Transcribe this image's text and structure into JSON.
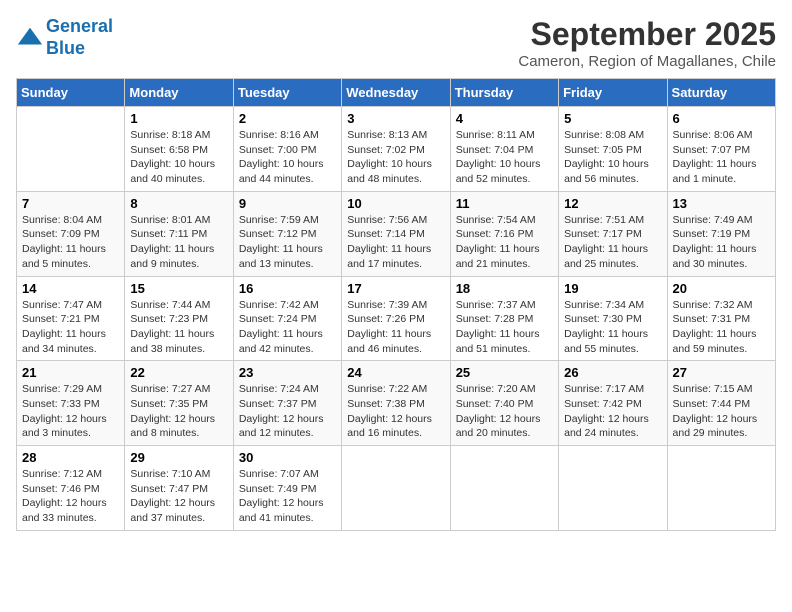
{
  "header": {
    "logo_line1": "General",
    "logo_line2": "Blue",
    "month_title": "September 2025",
    "subtitle": "Cameron, Region of Magallanes, Chile"
  },
  "calendar": {
    "days_of_week": [
      "Sunday",
      "Monday",
      "Tuesday",
      "Wednesday",
      "Thursday",
      "Friday",
      "Saturday"
    ],
    "weeks": [
      [
        {
          "day": "",
          "info": ""
        },
        {
          "day": "1",
          "info": "Sunrise: 8:18 AM\nSunset: 6:58 PM\nDaylight: 10 hours\nand 40 minutes."
        },
        {
          "day": "2",
          "info": "Sunrise: 8:16 AM\nSunset: 7:00 PM\nDaylight: 10 hours\nand 44 minutes."
        },
        {
          "day": "3",
          "info": "Sunrise: 8:13 AM\nSunset: 7:02 PM\nDaylight: 10 hours\nand 48 minutes."
        },
        {
          "day": "4",
          "info": "Sunrise: 8:11 AM\nSunset: 7:04 PM\nDaylight: 10 hours\nand 52 minutes."
        },
        {
          "day": "5",
          "info": "Sunrise: 8:08 AM\nSunset: 7:05 PM\nDaylight: 10 hours\nand 56 minutes."
        },
        {
          "day": "6",
          "info": "Sunrise: 8:06 AM\nSunset: 7:07 PM\nDaylight: 11 hours\nand 1 minute."
        }
      ],
      [
        {
          "day": "7",
          "info": "Sunrise: 8:04 AM\nSunset: 7:09 PM\nDaylight: 11 hours\nand 5 minutes."
        },
        {
          "day": "8",
          "info": "Sunrise: 8:01 AM\nSunset: 7:11 PM\nDaylight: 11 hours\nand 9 minutes."
        },
        {
          "day": "9",
          "info": "Sunrise: 7:59 AM\nSunset: 7:12 PM\nDaylight: 11 hours\nand 13 minutes."
        },
        {
          "day": "10",
          "info": "Sunrise: 7:56 AM\nSunset: 7:14 PM\nDaylight: 11 hours\nand 17 minutes."
        },
        {
          "day": "11",
          "info": "Sunrise: 7:54 AM\nSunset: 7:16 PM\nDaylight: 11 hours\nand 21 minutes."
        },
        {
          "day": "12",
          "info": "Sunrise: 7:51 AM\nSunset: 7:17 PM\nDaylight: 11 hours\nand 25 minutes."
        },
        {
          "day": "13",
          "info": "Sunrise: 7:49 AM\nSunset: 7:19 PM\nDaylight: 11 hours\nand 30 minutes."
        }
      ],
      [
        {
          "day": "14",
          "info": "Sunrise: 7:47 AM\nSunset: 7:21 PM\nDaylight: 11 hours\nand 34 minutes."
        },
        {
          "day": "15",
          "info": "Sunrise: 7:44 AM\nSunset: 7:23 PM\nDaylight: 11 hours\nand 38 minutes."
        },
        {
          "day": "16",
          "info": "Sunrise: 7:42 AM\nSunset: 7:24 PM\nDaylight: 11 hours\nand 42 minutes."
        },
        {
          "day": "17",
          "info": "Sunrise: 7:39 AM\nSunset: 7:26 PM\nDaylight: 11 hours\nand 46 minutes."
        },
        {
          "day": "18",
          "info": "Sunrise: 7:37 AM\nSunset: 7:28 PM\nDaylight: 11 hours\nand 51 minutes."
        },
        {
          "day": "19",
          "info": "Sunrise: 7:34 AM\nSunset: 7:30 PM\nDaylight: 11 hours\nand 55 minutes."
        },
        {
          "day": "20",
          "info": "Sunrise: 7:32 AM\nSunset: 7:31 PM\nDaylight: 11 hours\nand 59 minutes."
        }
      ],
      [
        {
          "day": "21",
          "info": "Sunrise: 7:29 AM\nSunset: 7:33 PM\nDaylight: 12 hours\nand 3 minutes."
        },
        {
          "day": "22",
          "info": "Sunrise: 7:27 AM\nSunset: 7:35 PM\nDaylight: 12 hours\nand 8 minutes."
        },
        {
          "day": "23",
          "info": "Sunrise: 7:24 AM\nSunset: 7:37 PM\nDaylight: 12 hours\nand 12 minutes."
        },
        {
          "day": "24",
          "info": "Sunrise: 7:22 AM\nSunset: 7:38 PM\nDaylight: 12 hours\nand 16 minutes."
        },
        {
          "day": "25",
          "info": "Sunrise: 7:20 AM\nSunset: 7:40 PM\nDaylight: 12 hours\nand 20 minutes."
        },
        {
          "day": "26",
          "info": "Sunrise: 7:17 AM\nSunset: 7:42 PM\nDaylight: 12 hours\nand 24 minutes."
        },
        {
          "day": "27",
          "info": "Sunrise: 7:15 AM\nSunset: 7:44 PM\nDaylight: 12 hours\nand 29 minutes."
        }
      ],
      [
        {
          "day": "28",
          "info": "Sunrise: 7:12 AM\nSunset: 7:46 PM\nDaylight: 12 hours\nand 33 minutes."
        },
        {
          "day": "29",
          "info": "Sunrise: 7:10 AM\nSunset: 7:47 PM\nDaylight: 12 hours\nand 37 minutes."
        },
        {
          "day": "30",
          "info": "Sunrise: 7:07 AM\nSunset: 7:49 PM\nDaylight: 12 hours\nand 41 minutes."
        },
        {
          "day": "",
          "info": ""
        },
        {
          "day": "",
          "info": ""
        },
        {
          "day": "",
          "info": ""
        },
        {
          "day": "",
          "info": ""
        }
      ]
    ]
  }
}
